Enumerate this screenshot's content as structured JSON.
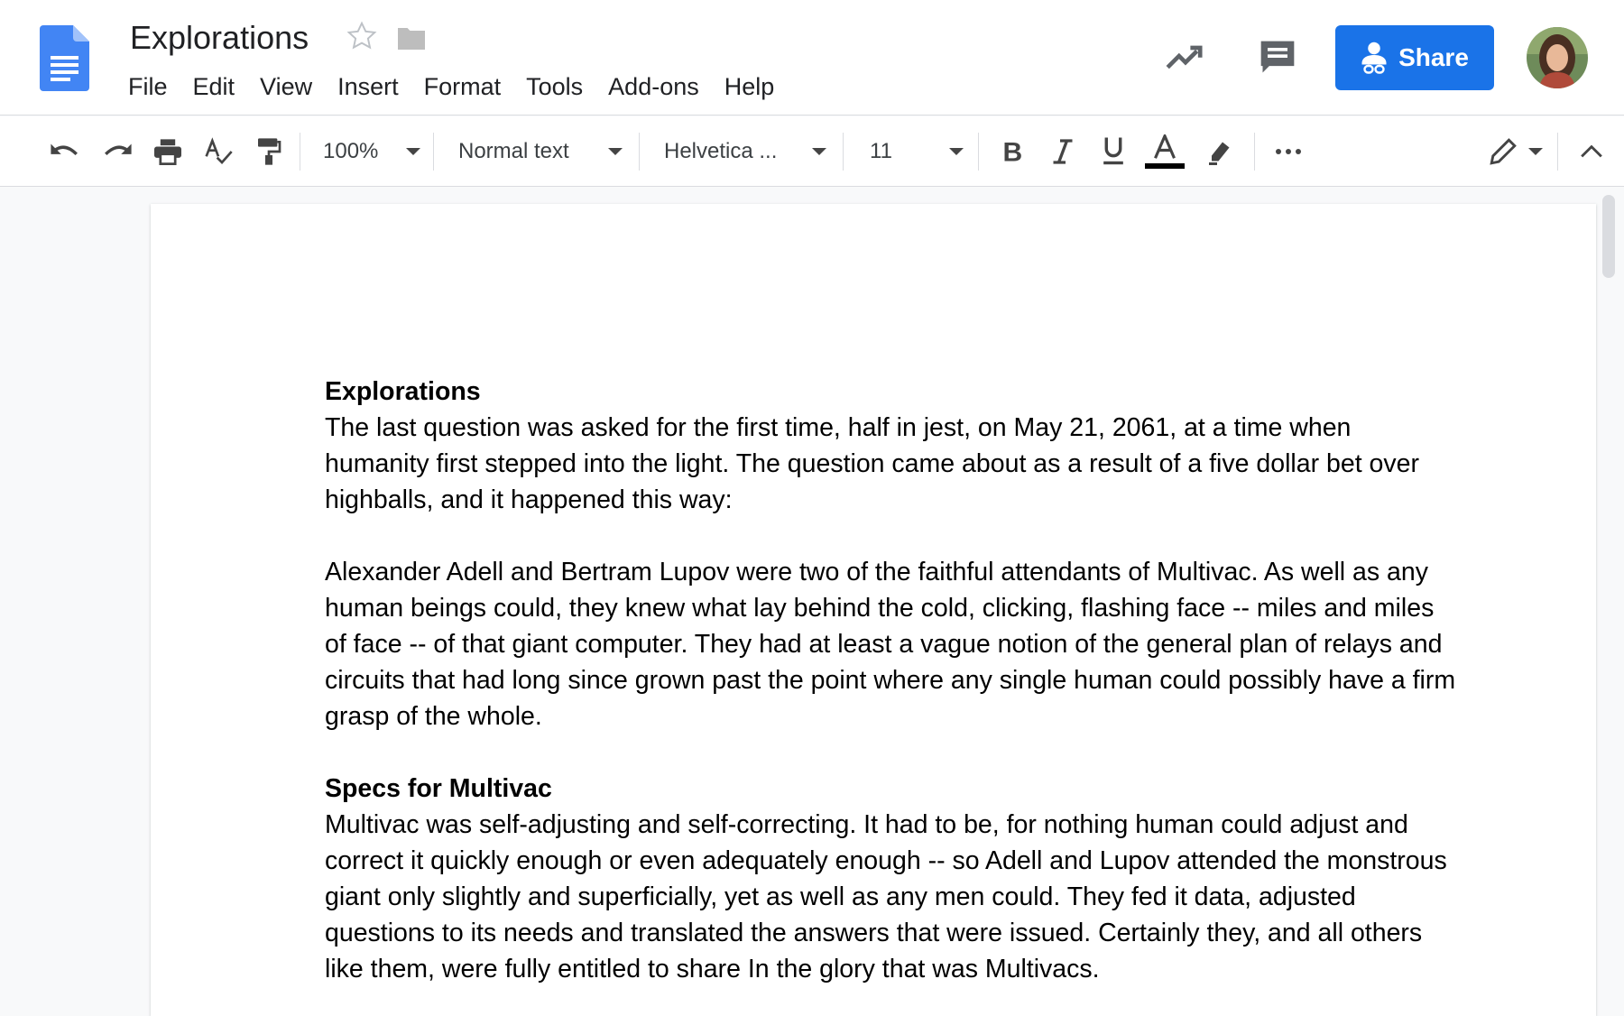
{
  "app": {
    "title": "Explorations",
    "menu": [
      "File",
      "Edit",
      "View",
      "Insert",
      "Format",
      "Tools",
      "Add-ons",
      "Help"
    ],
    "share_label": "Share",
    "accent_color": "#1a73e8"
  },
  "toolbar": {
    "zoom": "100%",
    "style": "Normal text",
    "font": "Helvetica ...",
    "font_size": "11",
    "icons": [
      "undo-icon",
      "redo-icon",
      "print-icon",
      "spellcheck-icon",
      "paint-format-icon",
      "bold-icon",
      "italic-icon",
      "underline-icon",
      "text-color-icon",
      "highlight-icon",
      "more-icon",
      "editing-mode-icon",
      "collapse-icon"
    ]
  },
  "document": {
    "heading1": "Explorations",
    "para1": "The last question was asked for the first time, half in jest, on May 21, 2061, at a time when humanity first stepped into the light. The question came about as a result of a five dollar bet over highballs, and it happened this way:",
    "para2": "Alexander Adell and Bertram Lupov were two of the faithful attendants of Multivac. As well as any human beings could, they knew what lay behind the cold, clicking, flashing face -- miles and miles of face -- of that giant computer. They had at least a vague notion of the general plan of relays and circuits that had long since grown past the point where any single human could possibly have a firm grasp of the whole.",
    "heading2": "Specs for Multivac",
    "para3": "Multivac was self-adjusting and self-correcting. It had to be, for nothing human could adjust and correct it quickly enough or even adequately enough -- so Adell and Lupov attended the monstrous giant only slightly and superficially, yet as well as any men could. They fed it data, adjusted questions to its needs and translated the answers that were issued. Certainly they, and all others like them, were fully entitled to share In the glory that was Multivacs."
  }
}
